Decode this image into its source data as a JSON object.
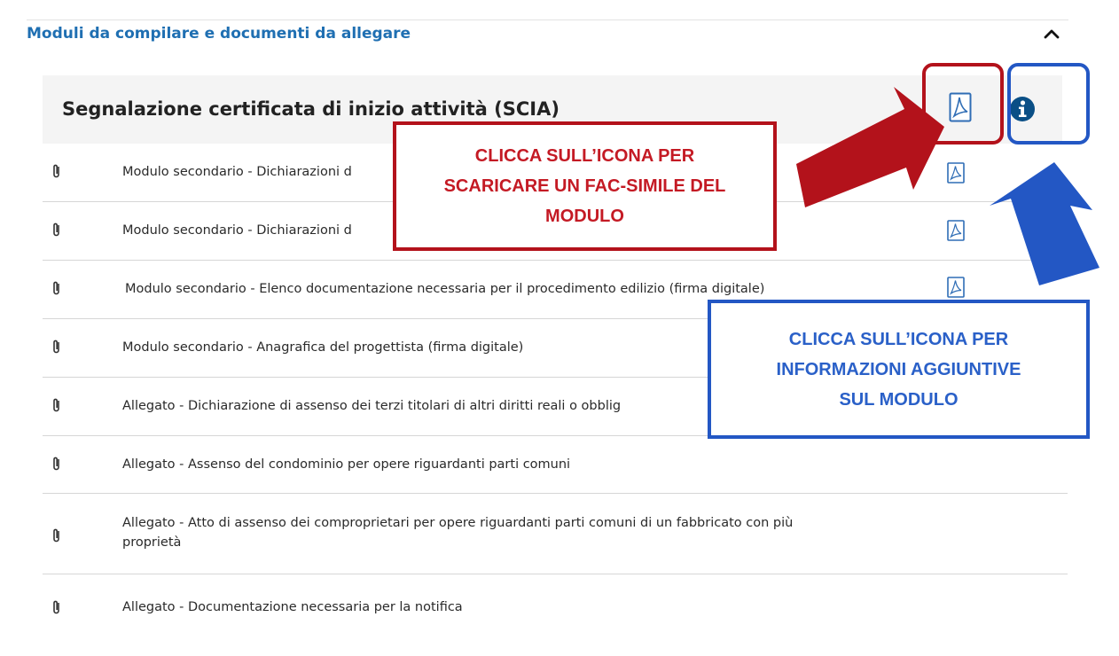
{
  "section": {
    "title": "Moduli da compilare e documenti da allegare",
    "toggle_icon": "chevron-up-icon"
  },
  "panel": {
    "title": "Segnalazione certificata di inizio attività (SCIA)",
    "download_icon": "pdf-icon",
    "info_icon": "info-icon"
  },
  "rows": [
    {
      "label": "Modulo secondario - Dichiarazioni d",
      "has_pdf": true
    },
    {
      "label": "Modulo secondario - Dichiarazioni d",
      "has_pdf": true
    },
    {
      "label": "Modulo secondario - Elenco documentazione necessaria per il procedimento edilizio (firma digitale)",
      "has_pdf": true
    },
    {
      "label": "Modulo secondario - Anagrafica del progettista (firma digitale)",
      "has_pdf": false
    },
    {
      "label": "Allegato - Dichiarazione di assenso dei terzi titolari di altri diritti reali o obblig",
      "has_pdf": false
    },
    {
      "label": "Allegato - Assenso del condominio per opere riguardanti parti comuni",
      "has_pdf": false
    },
    {
      "label_line1": "Allegato - Atto di assenso dei comproprietari per opere riguardanti parti comuni di un fabbricato con più",
      "label_line2": "proprietà",
      "has_pdf": false
    },
    {
      "label": "Allegato - Documentazione necessaria per la notifica",
      "has_pdf": false
    }
  ],
  "callouts": {
    "download": {
      "line1": "CLICCA SULL’ICONA PER",
      "line2": "SCARICARE UN FAC-SIMILE DEL",
      "line3": "MODULO",
      "color": "#c41a24"
    },
    "info": {
      "line1": "CLICCA SULL’ICONA PER",
      "line2": "INFORMAZIONI AGGIUNTIVE",
      "line3": "SUL MODULO",
      "color": "#2a60c8"
    }
  },
  "colors": {
    "link_blue": "#1f6fb2",
    "pdf_icon_blue": "#2f6db5",
    "annotation_red": "#b3121b",
    "annotation_blue": "#2357c4"
  }
}
